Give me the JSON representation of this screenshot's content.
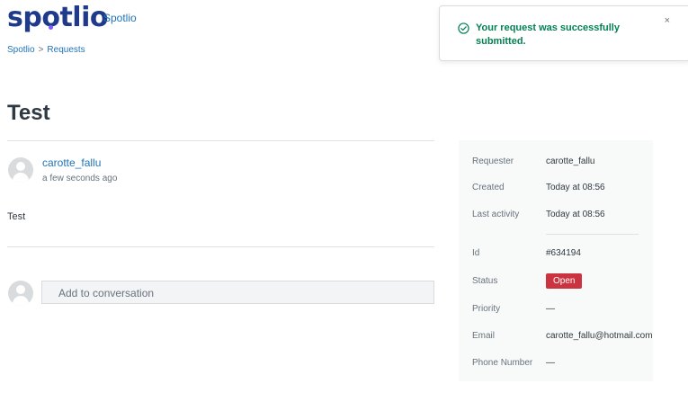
{
  "header": {
    "logo_text": "spotlio",
    "brand_name": "Spotlio",
    "colors": {
      "logo": "#1f3a8a",
      "logo_dot": "#7c5cff",
      "link": "#1f73b7"
    }
  },
  "breadcrumb": {
    "items": [
      "Spotlio",
      "Requests"
    ],
    "separator": ">"
  },
  "toast": {
    "icon": "check-circle-icon",
    "message": "Your request was successfully submitted.",
    "close_label": "×",
    "color": "#038153"
  },
  "request": {
    "title": "Test"
  },
  "comment": {
    "author": "carotte_fallu",
    "time": "a few seconds ago",
    "body": "Test",
    "avatar_icon": "user-avatar-icon"
  },
  "reply": {
    "placeholder": "Add to conversation",
    "avatar_icon": "user-avatar-icon"
  },
  "details": {
    "requester": {
      "label": "Requester",
      "value": "carotte_fallu"
    },
    "created": {
      "label": "Created",
      "value": "Today at 08:56"
    },
    "last_activity": {
      "label": "Last activity",
      "value": "Today at 08:56"
    },
    "id": {
      "label": "Id",
      "value": "#634194"
    },
    "status": {
      "label": "Status",
      "value": "Open",
      "color": "#cc3340"
    },
    "priority": {
      "label": "Priority",
      "value": "—"
    },
    "email": {
      "label": "Email",
      "value": "carotte_fallu@hotmail.com"
    },
    "phone": {
      "label": "Phone Number",
      "value": "—"
    }
  }
}
